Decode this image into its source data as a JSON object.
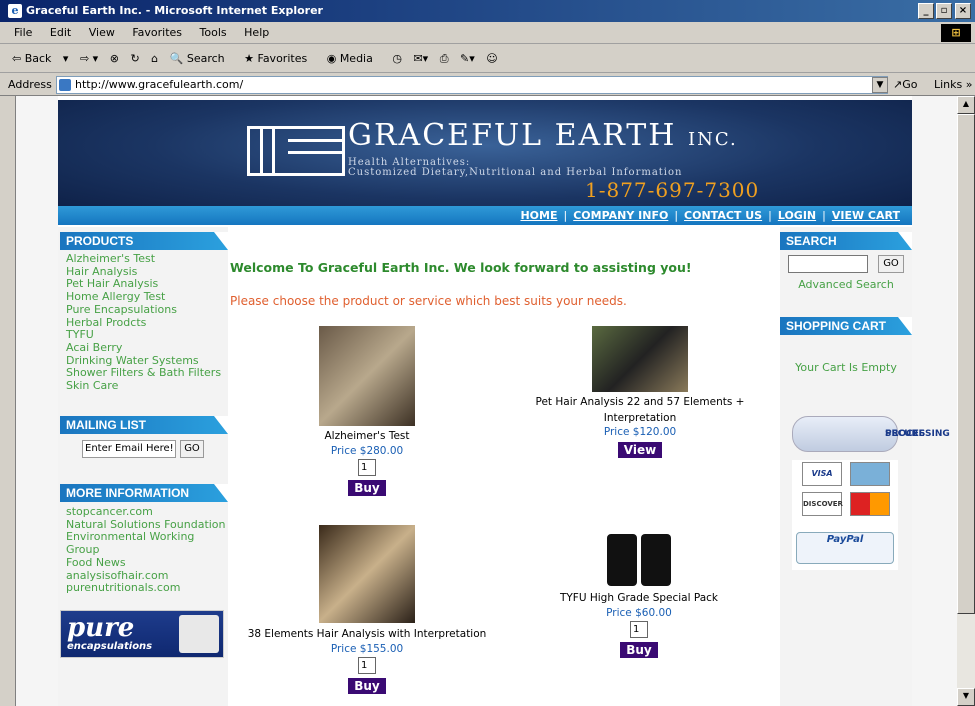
{
  "window": {
    "title": "Graceful Earth Inc. - Microsoft Internet Explorer"
  },
  "menu": [
    "File",
    "Edit",
    "View",
    "Favorites",
    "Tools",
    "Help"
  ],
  "toolbar": {
    "back": "Back",
    "search": "Search",
    "favorites": "Favorites",
    "media": "Media"
  },
  "address": {
    "label": "Address",
    "url": "http://www.gracefulearth.com/",
    "go": "Go",
    "links": "Links"
  },
  "header": {
    "brand": "GRACEFUL EARTH",
    "brand_suffix": "INC.",
    "tagline1": "Health Alternatives:",
    "tagline2": "Customized Dietary,Nutritional and Herbal Information",
    "phone": "1-877-697-7300"
  },
  "nav": [
    "HOME",
    "COMPANY INFO",
    "CONTACT US",
    "LOGIN",
    "VIEW CART"
  ],
  "products": {
    "heading": "PRODUCTS",
    "items": [
      "Alzheimer's Test",
      "Hair Analysis",
      "Pet Hair Analysis",
      "Home Allergy Test",
      "Pure Encapsulations",
      "Herbal Prodcts",
      "TYFU",
      "Acai Berry",
      "Drinking Water Systems",
      "Shower Filters & Bath Filters",
      "Skin Care"
    ]
  },
  "mailing": {
    "heading": "MAILING LIST",
    "placeholder": "Enter Email Here!",
    "go": "GO"
  },
  "more_info": {
    "heading": "MORE INFORMATION",
    "items": [
      "stopcancer.com",
      "Natural Solutions Foundation",
      "Environmental Working",
      "Group",
      "Food News",
      "analysisofhair.com",
      "purenutritionals.com"
    ]
  },
  "pure_ad": {
    "line1": "pure",
    "line2": "encapsulations"
  },
  "main": {
    "welcome": "Welcome To Graceful Earth Inc. We look forward to assisting you!",
    "choose": "Please choose the product or service which best suits your needs."
  },
  "product_grid": [
    {
      "name": "Alzheimer's Test",
      "price": "Price $280.00",
      "qty": "1",
      "button": "Buy"
    },
    {
      "name_line1": "Pet Hair Analysis 22 and 57 Elements +",
      "name_line2": "Interpretation",
      "price": "Price $120.00",
      "button": "View"
    },
    {
      "name": "38 Elements Hair Analysis with Interpretation",
      "price": "Price $155.00",
      "qty": "1",
      "button": "Buy"
    },
    {
      "name": "TYFU High Grade Special Pack",
      "price": "Price $60.00",
      "qty": "1",
      "button": "Buy"
    }
  ],
  "search": {
    "heading": "SEARCH",
    "go": "GO",
    "advanced": "Advanced Search"
  },
  "cart": {
    "heading": "SHOPPING CART",
    "status": "Your Cart Is Empty"
  },
  "badges": {
    "secure": "SECURE",
    "secure2": "PROCESSING",
    "visa": "VISA",
    "discover": "DISCOVER",
    "paypal": "PayPal"
  }
}
